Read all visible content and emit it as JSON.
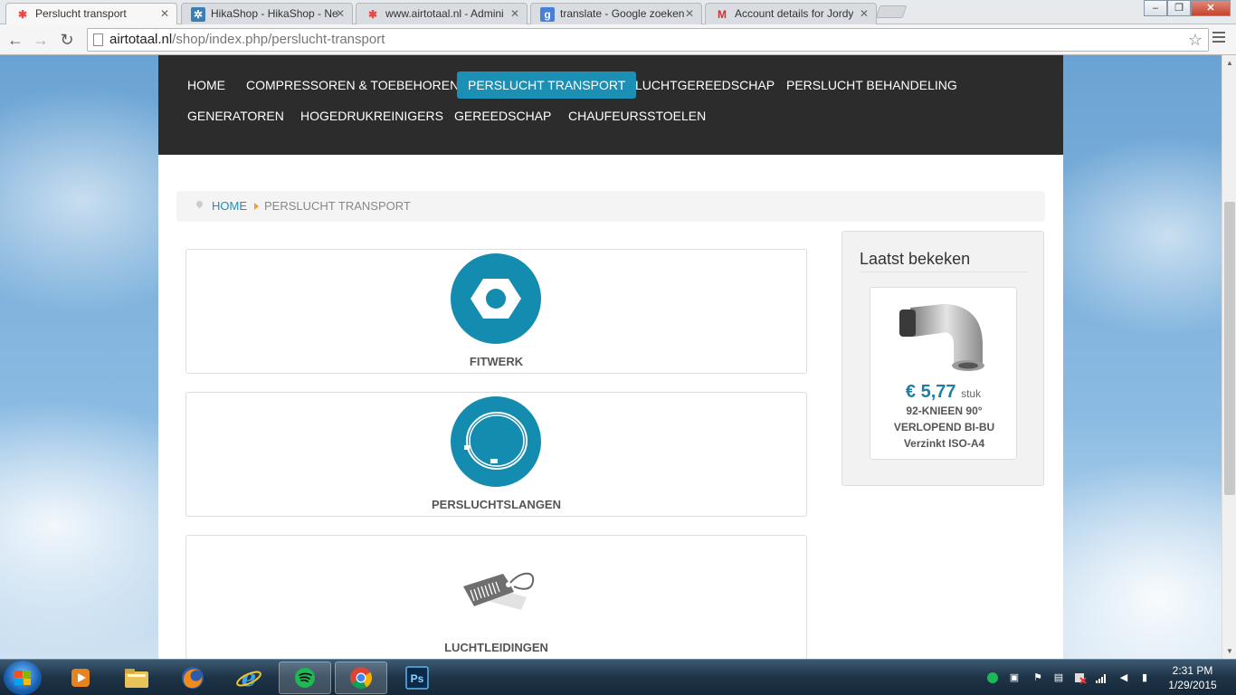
{
  "browser": {
    "tabs": [
      {
        "label": "Perslucht transport",
        "active": true,
        "icon": "joomla-icon"
      },
      {
        "label": "HikaShop - HikaShop - Ne",
        "active": false,
        "icon": "hikashop-icon"
      },
      {
        "label": "www.airtotaal.nl - Admini",
        "active": false,
        "icon": "joomla-icon"
      },
      {
        "label": "translate - Google zoeken",
        "active": false,
        "icon": "google-icon"
      },
      {
        "label": "Account details for Jordy",
        "active": false,
        "icon": "gmail-icon"
      }
    ],
    "url_host": "airtotaal.nl",
    "url_path": "/shop/index.php/perslucht-transport"
  },
  "site": {
    "nav": [
      {
        "label": "HOME",
        "active": false
      },
      {
        "label": "COMPRESSOREN & TOEBEHOREN",
        "active": false
      },
      {
        "label": "PERSLUCHT TRANSPORT",
        "active": true
      },
      {
        "label": "LUCHTGEREEDSCHAP",
        "active": false
      },
      {
        "label": "PERSLUCHT BEHANDELING",
        "active": false
      },
      {
        "label": "GENERATOREN",
        "active": false
      },
      {
        "label": "HOGEDRUKREINIGERS",
        "active": false
      },
      {
        "label": "GEREEDSCHAP",
        "active": false
      },
      {
        "label": "CHAUFEURSSTOELEN",
        "active": false
      }
    ],
    "breadcrumb": {
      "home": "HOME",
      "current": "PERSLUCHT TRANSPORT"
    },
    "categories": [
      {
        "name": "FITWERK",
        "icon": "hex-nut-icon"
      },
      {
        "name": "PERSLUCHTSLANGEN",
        "icon": "hose-icon"
      },
      {
        "name": "LUCHTLEIDINGEN",
        "icon": "price-tag-icon"
      }
    ],
    "sidebar": {
      "title": "Laatst bekeken",
      "product": {
        "price": "€ 5,77",
        "unit": "stuk",
        "name": "92-KNIEEN 90° VERLOPEND BI-BU Verzinkt ISO-A4",
        "image": "galvanized-elbow-fitting-image"
      }
    },
    "colors": {
      "accent": "#1b8fb4",
      "nav_bg": "#2c2c2c",
      "price": "#1d7fa3"
    }
  },
  "taskbar": {
    "apps": [
      "windows-media-player-icon",
      "file-explorer-icon",
      "firefox-icon",
      "internet-explorer-icon",
      "spotify-icon",
      "chrome-icon",
      "photoshop-icon"
    ],
    "time": "2:31 PM",
    "date": "1/29/2015"
  }
}
